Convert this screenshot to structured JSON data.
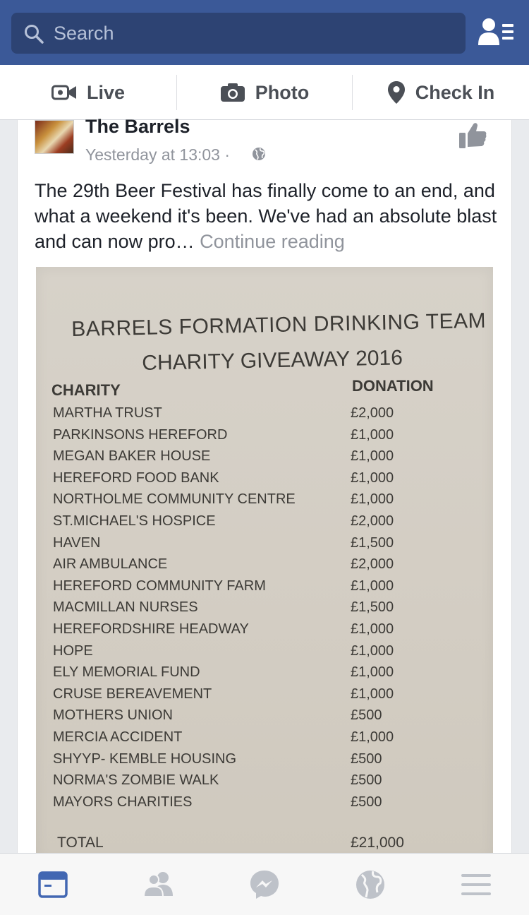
{
  "header": {
    "search_placeholder": "Search",
    "search_icon": "search-icon",
    "friends_icon": "friend-requests-icon",
    "bg_color": "#3b5998"
  },
  "composer": {
    "live_label": "Live",
    "photo_label": "Photo",
    "checkin_label": "Check In"
  },
  "post": {
    "author": "The Barrels",
    "timestamp": "Yesterday at 13:03 ·",
    "text": "The 29th Beer Festival has finally come to an end, and what a weekend it's been. We've had an absolute blast and can now pro…",
    "continue_label": "Continue reading",
    "photo": {
      "title_line1": "BARRELS FORMATION DRINKING TEAM",
      "title_line2": "CHARITY GIVEAWAY 2016",
      "col_charity": "CHARITY",
      "col_donation": "DONATION",
      "rows": [
        {
          "charity": "MARTHA TRUST",
          "donation": "£2,000"
        },
        {
          "charity": "PARKINSONS HEREFORD",
          "donation": "£1,000"
        },
        {
          "charity": "MEGAN BAKER HOUSE",
          "donation": "£1,000"
        },
        {
          "charity": "HEREFORD FOOD BANK",
          "donation": "£1,000"
        },
        {
          "charity": "NORTHOLME COMMUNITY CENTRE",
          "donation": "£1,000"
        },
        {
          "charity": "ST.MICHAEL'S HOSPICE",
          "donation": "£2,000"
        },
        {
          "charity": "HAVEN",
          "donation": "£1,500"
        },
        {
          "charity": "AIR AMBULANCE",
          "donation": "£2,000"
        },
        {
          "charity": "HEREFORD COMMUNITY FARM",
          "donation": "£1,000"
        },
        {
          "charity": "MACMILLAN NURSES",
          "donation": "£1,500"
        },
        {
          "charity": "HEREFORDSHIRE HEADWAY",
          "donation": "£1,000"
        },
        {
          "charity": "HOPE",
          "donation": "£1,000"
        },
        {
          "charity": "ELY MEMORIAL FUND",
          "donation": "£1,000"
        },
        {
          "charity": "CRUSE BEREAVEMENT",
          "donation": "£1,000"
        },
        {
          "charity": "MOTHERS UNION",
          "donation": "£500"
        },
        {
          "charity": "MERCIA ACCIDENT",
          "donation": "£1,000"
        },
        {
          "charity": "SHYYP- KEMBLE HOUSING",
          "donation": "£500"
        },
        {
          "charity": "NORMA'S ZOMBIE WALK",
          "donation": "£500"
        },
        {
          "charity": "MAYORS CHARITIES",
          "donation": "£500"
        }
      ],
      "total_label": "TOTAL",
      "total_value": "£21,000"
    }
  },
  "tabbar": {
    "items": [
      "news-feed-icon",
      "friends-icon",
      "messenger-icon",
      "notifications-globe-icon",
      "menu-icon"
    ],
    "active_color": "#4267b2",
    "inactive_color": "#bec2c9"
  }
}
